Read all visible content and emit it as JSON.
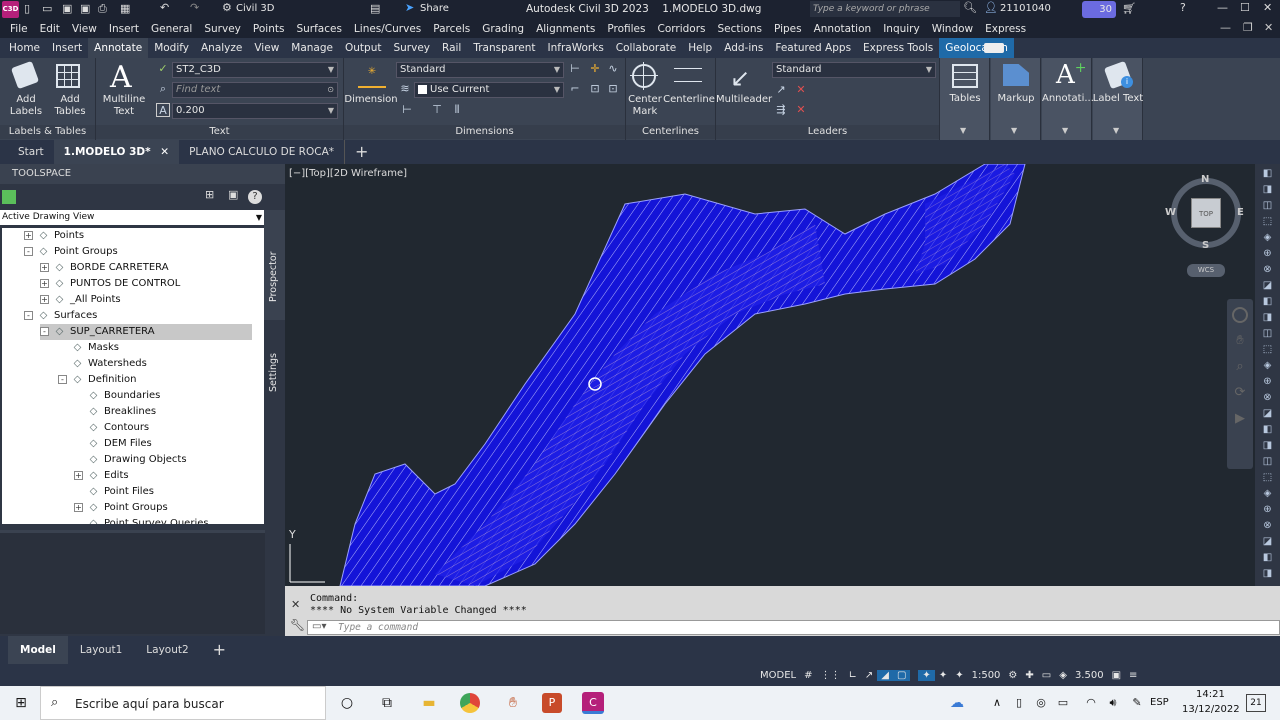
{
  "app": {
    "logo": "C3D",
    "workspace": "Civil 3D",
    "share": "Share",
    "title": "Autodesk Civil 3D 2023    1.MODELO 3D.dwg",
    "search_placeholder": "Type a keyword or phrase",
    "user": "21101040",
    "notif": "30"
  },
  "menu": [
    "File",
    "Edit",
    "View",
    "Insert",
    "General",
    "Survey",
    "Points",
    "Surfaces",
    "Lines/Curves",
    "Parcels",
    "Grading",
    "Alignments",
    "Profiles",
    "Corridors",
    "Sections",
    "Pipes",
    "Annotation",
    "Inquiry",
    "Window",
    "Express"
  ],
  "ribbon_tabs": [
    "Home",
    "Insert",
    "Annotate",
    "Modify",
    "Analyze",
    "View",
    "Manage",
    "Output",
    "Survey",
    "Rail",
    "Transparent",
    "InfraWorks",
    "Collaborate",
    "Help",
    "Add-ins",
    "Featured Apps",
    "Express Tools",
    "Geolocation"
  ],
  "ribbon": {
    "labels_tables": {
      "title": "Labels & Tables",
      "add_labels": "Add\nLabels",
      "add_tables": "Add\nTables"
    },
    "text": {
      "title": "Text",
      "multiline": "Multiline\nText",
      "style": "ST2_C3D",
      "find": "Find text",
      "height": "0.200"
    },
    "dimensions": {
      "title": "Dimensions",
      "dimension": "Dimension",
      "style": "Standard",
      "layer": "Use Current"
    },
    "centerlines": {
      "title": "Centerlines",
      "center_mark": "Center\nMark",
      "centerline": "Centerline"
    },
    "leaders": {
      "title": "Leaders",
      "multileader": "Multileader",
      "style": "Standard"
    },
    "extra": {
      "tables": "Tables",
      "markup": "Markup",
      "annotation": "Annotati...",
      "label_text": "Label Text"
    }
  },
  "doc_tabs": [
    "Start",
    "1.MODELO 3D*",
    "PLANO CALCULO DE ROCA*"
  ],
  "toolspace": {
    "title": "TOOLSPACE",
    "view": "Active Drawing View",
    "side_tabs": [
      "Prospector",
      "Settings"
    ]
  },
  "tree": [
    {
      "label": "Points",
      "level": 1,
      "exp": "+"
    },
    {
      "label": "Point Groups",
      "level": 1,
      "exp": "-"
    },
    {
      "label": "BORDE CARRETERA",
      "level": 2,
      "exp": "+"
    },
    {
      "label": "PUNTOS DE CONTROL",
      "level": 2,
      "exp": "+"
    },
    {
      "label": "_All Points",
      "level": 2,
      "exp": "+"
    },
    {
      "label": "Surfaces",
      "level": 1,
      "exp": "-"
    },
    {
      "label": "SUP_CARRETERA",
      "level": 2,
      "exp": "-",
      "selected": true
    },
    {
      "label": "Masks",
      "level": 3,
      "exp": ""
    },
    {
      "label": "Watersheds",
      "level": 3,
      "exp": ""
    },
    {
      "label": "Definition",
      "level": 3,
      "exp": "-"
    },
    {
      "label": "Boundaries",
      "level": 4,
      "exp": ""
    },
    {
      "label": "Breaklines",
      "level": 4,
      "exp": ""
    },
    {
      "label": "Contours",
      "level": 4,
      "exp": ""
    },
    {
      "label": "DEM Files",
      "level": 4,
      "exp": ""
    },
    {
      "label": "Drawing Objects",
      "level": 4,
      "exp": ""
    },
    {
      "label": "Edits",
      "level": 4,
      "exp": "+"
    },
    {
      "label": "Point Files",
      "level": 4,
      "exp": ""
    },
    {
      "label": "Point Groups",
      "level": 4,
      "exp": "+"
    },
    {
      "label": "Point Survey Queries",
      "level": 4,
      "exp": ""
    }
  ],
  "viewport": {
    "label": "[−][Top][2D Wireframe]",
    "compass": {
      "n": "N",
      "s": "S",
      "e": "E",
      "w": "W",
      "top": "TOP",
      "wcs": "WCS"
    },
    "axis_y": "Y"
  },
  "command": {
    "line1": "Command:",
    "line2": "**** No System Variable Changed ****",
    "placeholder": "Type a command"
  },
  "layout_tabs": [
    "Model",
    "Layout1",
    "Layout2"
  ],
  "status": {
    "model": "MODEL",
    "scale": "1:500",
    "value": "3.500"
  },
  "taskbar": {
    "search": "Escribe aquí para buscar",
    "lang": "ESP",
    "time": "14:21",
    "date": "13/12/2022",
    "badge": "21"
  },
  "colors": {
    "accent": "#1f6aa8",
    "surface": "#1010e0"
  }
}
